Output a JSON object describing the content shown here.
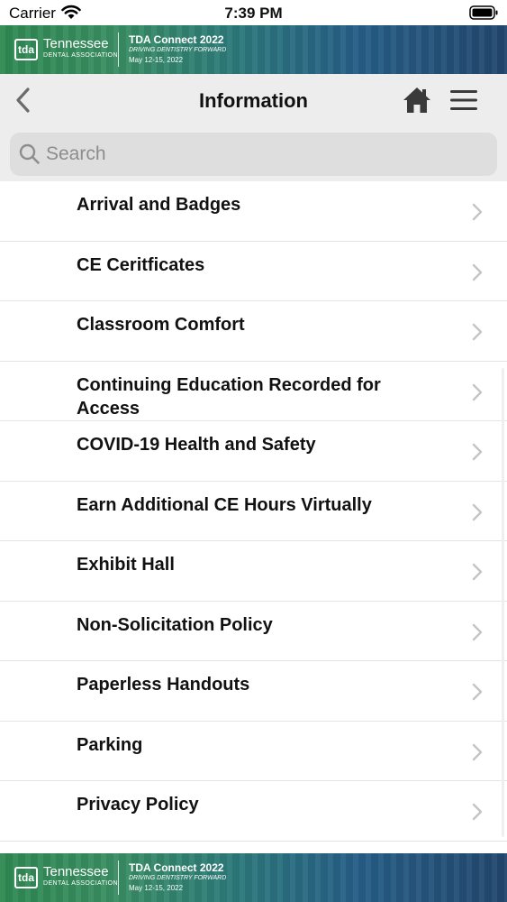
{
  "status_bar": {
    "carrier": "Carrier",
    "time": "7:39 PM"
  },
  "banner": {
    "logo_mark": "tda",
    "org_name": "Tennessee",
    "org_sub": "DENTAL ASSOCIATION",
    "event_title": "TDA Connect 2022",
    "event_tagline": "DRIVING DENTISTRY FORWARD",
    "event_dates": "May 12-15, 2022"
  },
  "nav": {
    "title": "Information",
    "icons": [
      "back-chevron-icon",
      "home-icon",
      "hamburger-menu-icon"
    ]
  },
  "search": {
    "placeholder": "Search",
    "value": ""
  },
  "items": [
    {
      "label": "Arrival and Badges"
    },
    {
      "label": "CE Ceritficates"
    },
    {
      "label": "Classroom Comfort"
    },
    {
      "label": "Continuing Education Recorded for Access"
    },
    {
      "label": "COVID-19 Health and Safety"
    },
    {
      "label": "Earn Additional CE Hours Virtually"
    },
    {
      "label": "Exhibit Hall"
    },
    {
      "label": "Non-Solicitation Policy"
    },
    {
      "label": "Paperless Handouts"
    },
    {
      "label": "Parking"
    },
    {
      "label": "Privacy Policy"
    }
  ],
  "colors": {
    "nav_background": "#ededed",
    "search_background": "#dedede",
    "chevron": "#c4c4c4",
    "banner_start": "#2f8a52",
    "banner_end": "#23486f"
  }
}
